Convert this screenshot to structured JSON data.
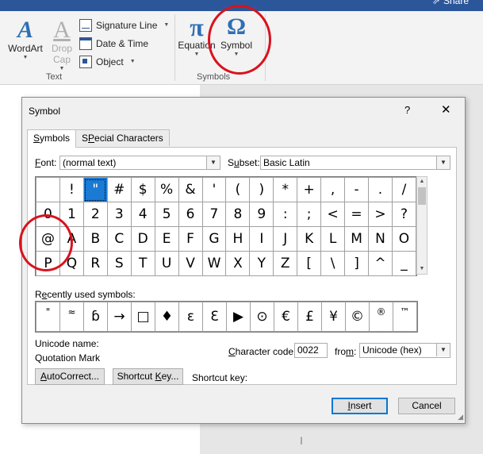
{
  "ribbon": {
    "share_label": "Share",
    "wordart": {
      "label": "WordArt",
      "glyph": "A"
    },
    "dropcap": {
      "label1": "Drop",
      "label2": "Cap",
      "glyph": "A"
    },
    "text_items": [
      {
        "label": "Signature Line",
        "icon": "signature-line-icon"
      },
      {
        "label": "Date & Time",
        "icon": "date-time-icon"
      },
      {
        "label": "Object",
        "icon": "object-icon"
      }
    ],
    "text_group_label": "Text",
    "equation": {
      "label": "Equation",
      "glyph": "π"
    },
    "symbol": {
      "label": "Symbol",
      "glyph": "Ω"
    },
    "symbols_group_label": "Symbols"
  },
  "dialog": {
    "title": "Symbol",
    "help": "?",
    "close": "✕",
    "tabs": [
      {
        "label": "Symbols",
        "accel": "S",
        "rest": "ymbols"
      },
      {
        "label": "Special Characters",
        "accel": "P",
        "pre": "S",
        "rest": "ecial Characters"
      }
    ],
    "font_label_accel": "F",
    "font_label_rest": "ont:",
    "font_value": "(normal text)",
    "subset_label_pre": "S",
    "subset_label_accel": "u",
    "subset_label_rest": "bset:",
    "subset_value": "Basic Latin",
    "grid": [
      [
        "",
        "!",
        "\"",
        "#",
        "$",
        "%",
        "&",
        "'",
        "(",
        ")",
        "*",
        "+",
        ",",
        "-",
        ".",
        "/"
      ],
      [
        "0",
        "1",
        "2",
        "3",
        "4",
        "5",
        "6",
        "7",
        "8",
        "9",
        ":",
        ";",
        "<",
        "=",
        ">",
        "?"
      ],
      [
        "@",
        "A",
        "B",
        "C",
        "D",
        "E",
        "F",
        "G",
        "H",
        "I",
        "J",
        "K",
        "L",
        "M",
        "N",
        "O"
      ],
      [
        "P",
        "Q",
        "R",
        "S",
        "T",
        "U",
        "V",
        "W",
        "X",
        "Y",
        "Z",
        "[",
        "\\",
        "]",
        "^",
        "_"
      ]
    ],
    "selected_cell": [
      0,
      2
    ],
    "recent_label_pre": "R",
    "recent_label_accel": "e",
    "recent_label_rest": "cently used symbols:",
    "recent": [
      "\"",
      "≈",
      "ɓ",
      "→",
      "□",
      "♦",
      "ε",
      "Ɛ",
      "▶",
      "⊙",
      "€",
      "£",
      "¥",
      "©",
      "®",
      "™"
    ],
    "unicode_name_label": "Unicode name:",
    "unicode_name_value": "Quotation Mark",
    "char_code_label_accel": "C",
    "char_code_label_rest": "haracter code:",
    "char_code_value": "0022",
    "from_label_pre": "fro",
    "from_label_accel": "m",
    "from_label_rest": ":",
    "from_value": "Unicode (hex)",
    "autocorrect_accel": "A",
    "autocorrect_rest": "utoCorrect...",
    "shortcutkey_pre": "Shortcut ",
    "shortcutkey_accel": "K",
    "shortcutkey_rest": "ey...",
    "shortcut_key_label": "Shortcut key:",
    "insert_accel": "I",
    "insert_rest": "nsert",
    "cancel_label": "Cancel"
  },
  "colors": {
    "accent": "#2b579a",
    "selection": "#1a7ad4",
    "annotation": "#d9121d"
  }
}
